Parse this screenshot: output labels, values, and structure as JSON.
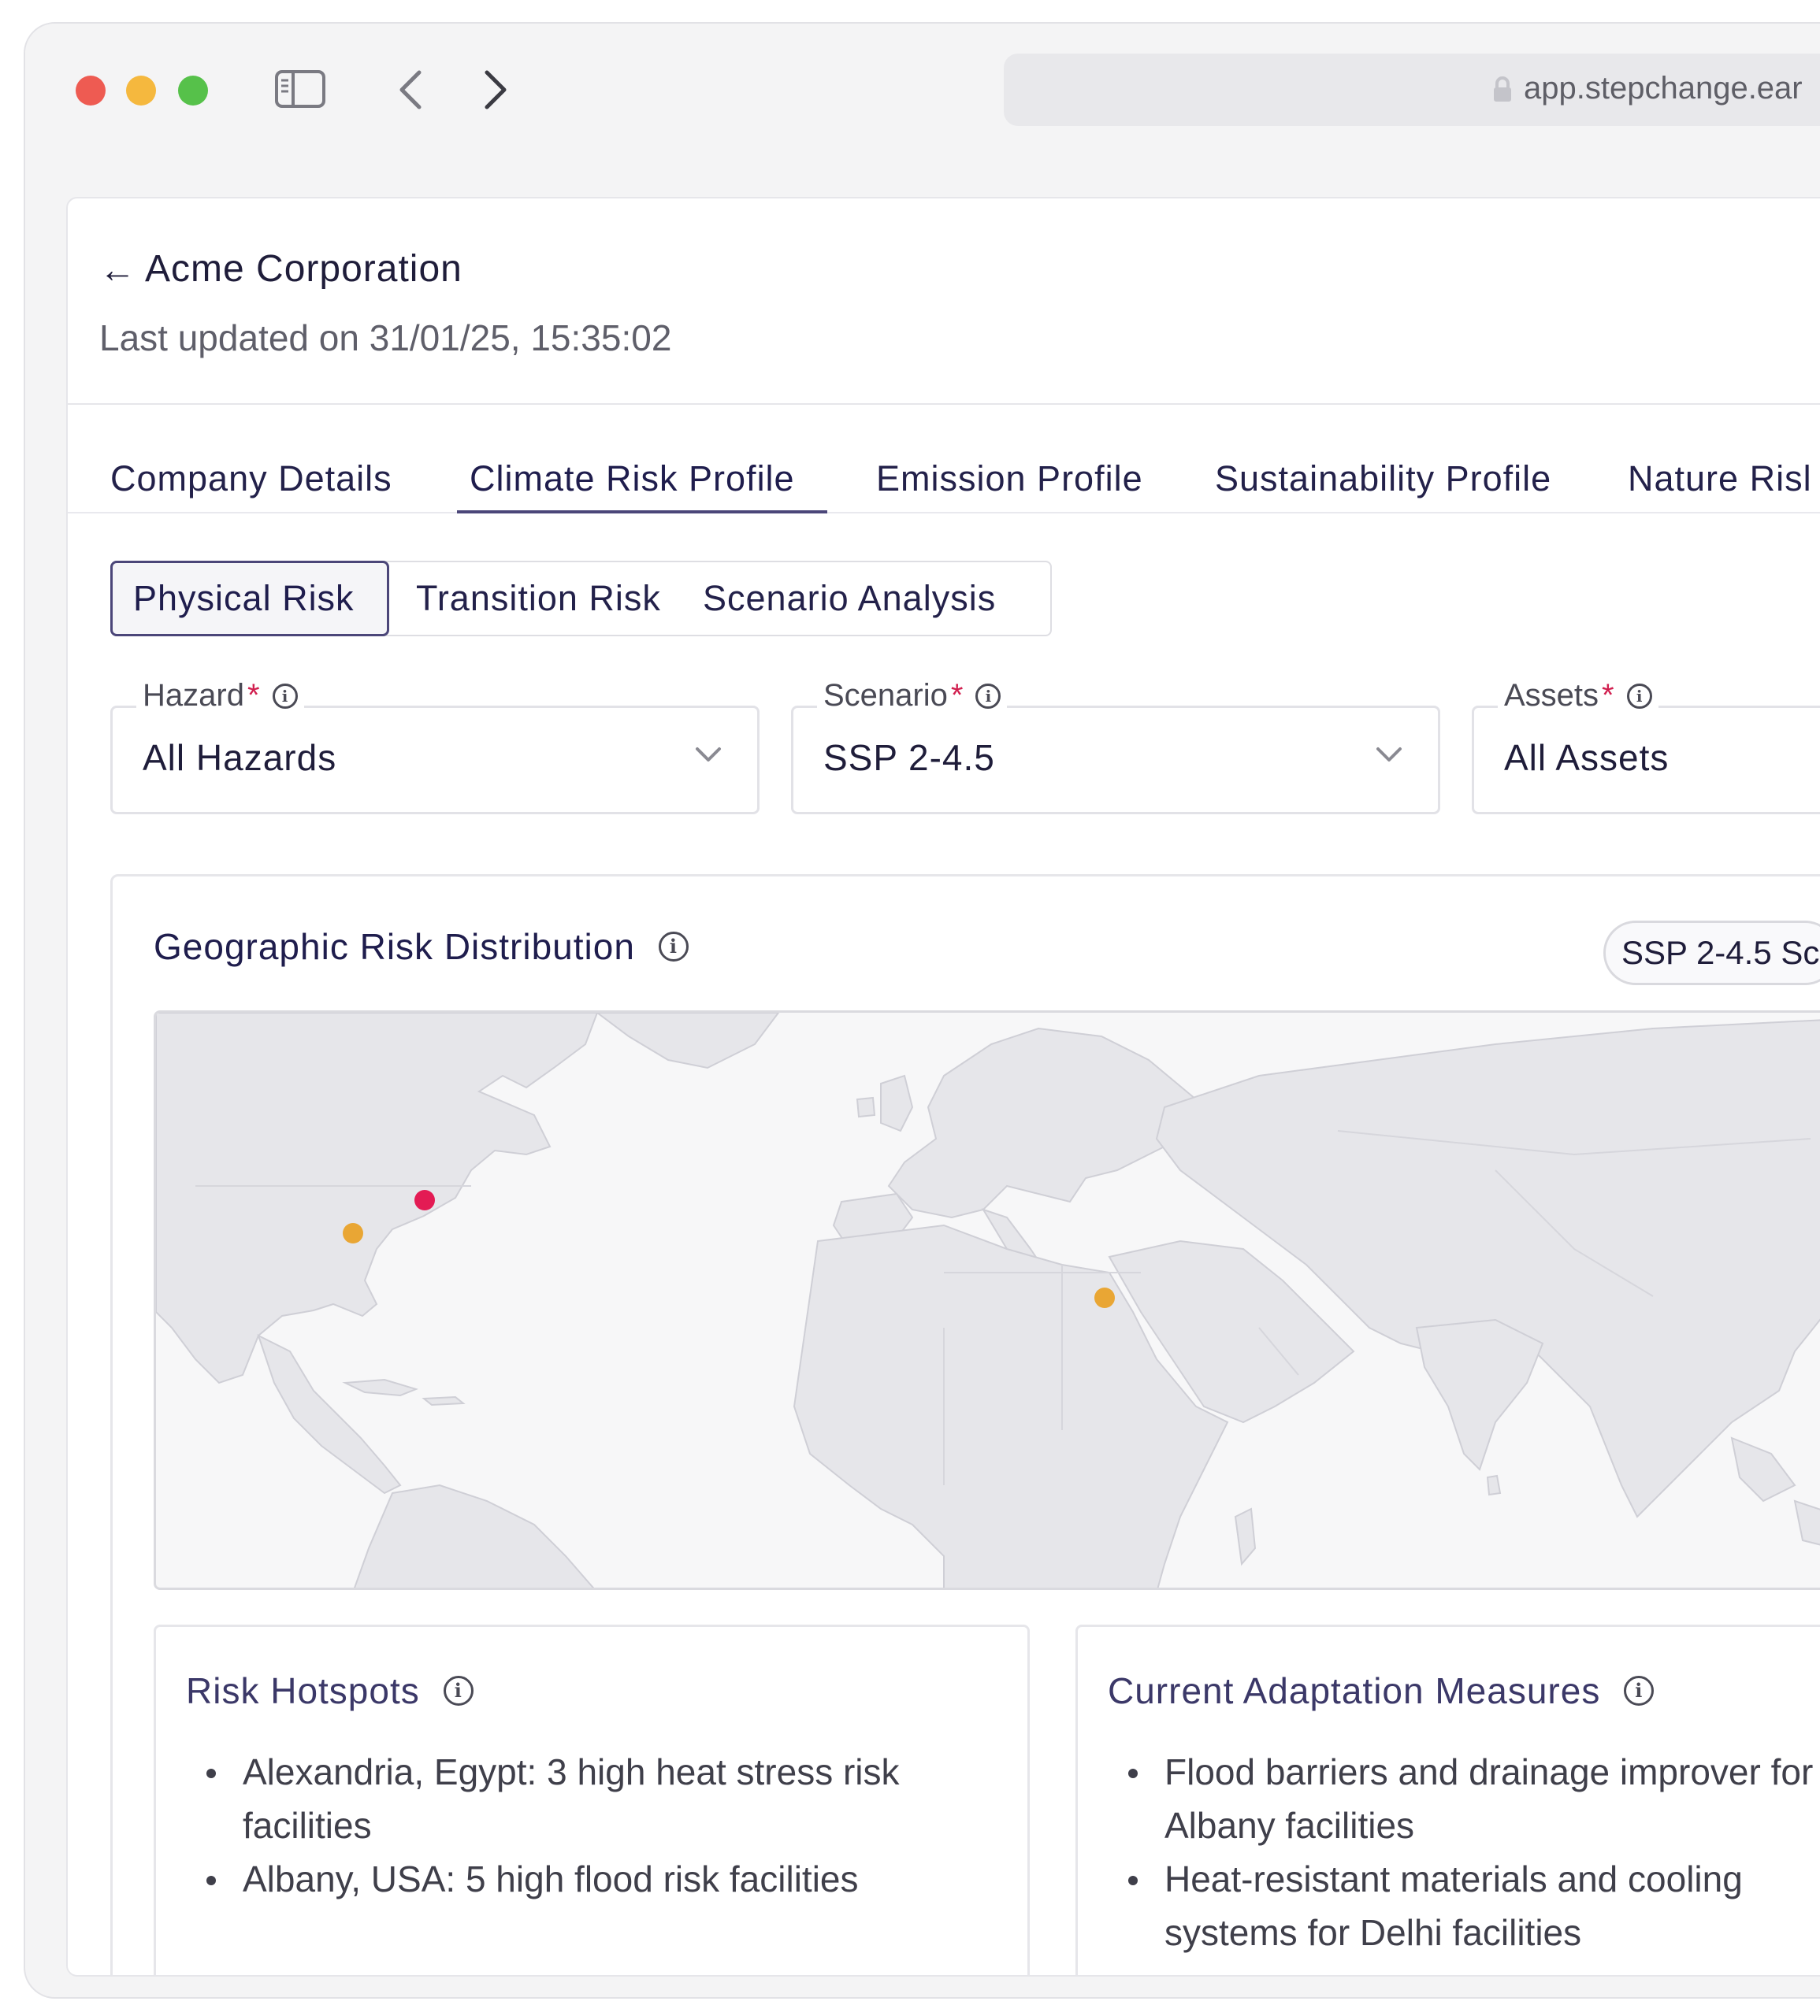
{
  "browser": {
    "url": "app.stepchange.ear"
  },
  "header": {
    "back_label": "Acme Corporation",
    "last_updated": "Last updated on 31/01/25, 15:35:02"
  },
  "tabs": [
    {
      "label": "Company Details"
    },
    {
      "label": "Climate Risk Profile",
      "active": true
    },
    {
      "label": "Emission Profile"
    },
    {
      "label": "Sustainability Profile"
    },
    {
      "label": "Nature Risl"
    }
  ],
  "subtabs": [
    {
      "label": "Physical Risk",
      "active": true
    },
    {
      "label": "Transition Risk"
    },
    {
      "label": "Scenario Analysis"
    }
  ],
  "filters": {
    "hazard": {
      "label": "Hazard",
      "required": "*",
      "value": "All Hazards"
    },
    "scenario": {
      "label": "Scenario",
      "required": "*",
      "value": "SSP 2-4.5"
    },
    "assets": {
      "label": "Assets",
      "required": "*",
      "value": "All Assets"
    }
  },
  "map_card": {
    "title": "Geographic Risk Distribution",
    "scenario_pill": "SSP 2-4.5 Sc",
    "markers": [
      {
        "location": "Albany, USA",
        "risk": "high",
        "color": "#e31b54"
      },
      {
        "location": "USA Midwest",
        "risk": "medium",
        "color": "#e9a634"
      },
      {
        "location": "Alexandria, Egypt",
        "risk": "medium",
        "color": "#e9a634"
      }
    ]
  },
  "hotspots": {
    "title": "Risk Hotspots",
    "items": [
      "Alexandria, Egypt: 3 high heat stress risk facilities",
      "Albany, USA: 5 high flood risk facilities"
    ]
  },
  "adaptation": {
    "title": "Current Adaptation Measures",
    "items": [
      "Flood barriers and drainage improver for Albany facilities",
      "Heat-resistant materials and cooling systems for Delhi facilities"
    ]
  },
  "colors": {
    "accent": "#4b4679",
    "required": "#d11f4f",
    "land": "#e6e6ea",
    "land_border": "#cfcfd6"
  }
}
